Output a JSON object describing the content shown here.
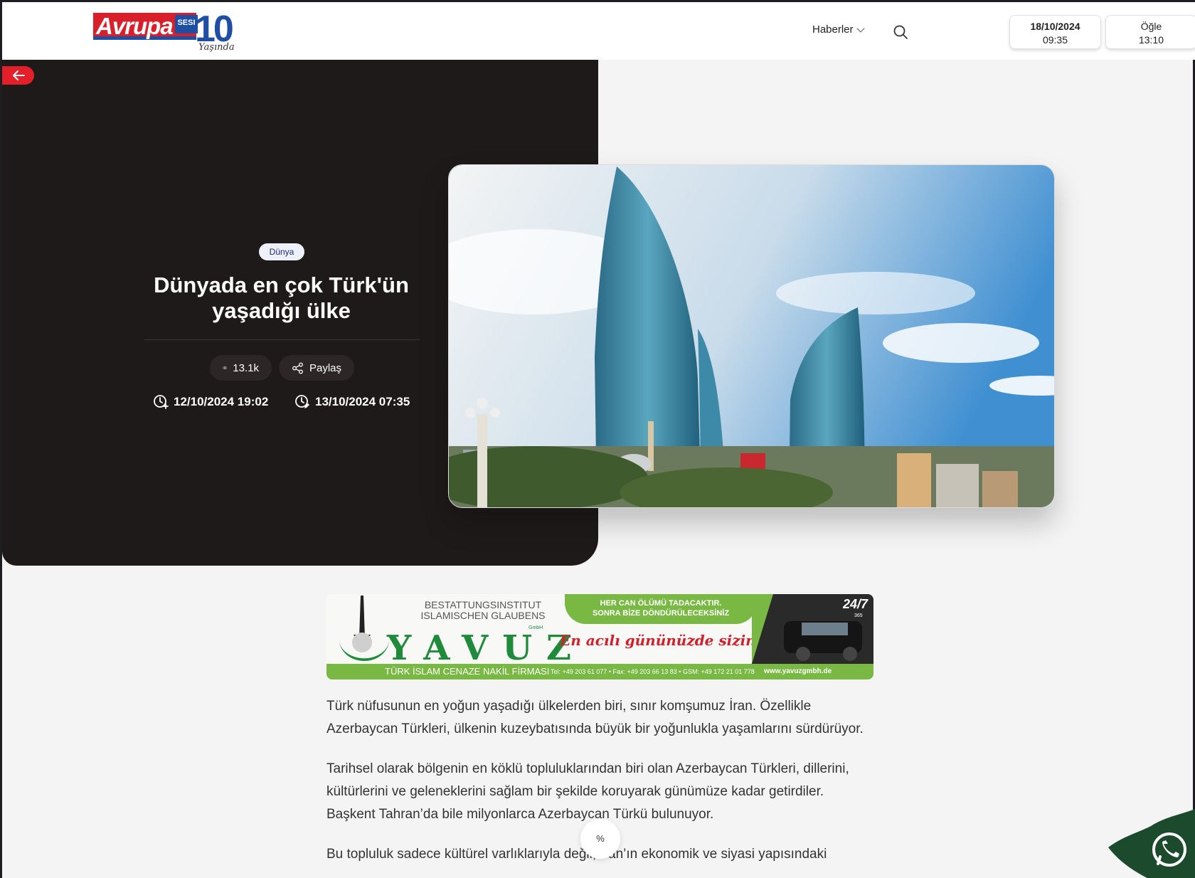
{
  "header": {
    "logo": {
      "word": "Avrupa",
      "sub": "SESI",
      "number": "10",
      "tagline": "Yaşında"
    },
    "nav_haberler": "Haberler",
    "date_box": {
      "date": "18/10/2024",
      "time": "09:35"
    },
    "prayer_box": {
      "name": "Öğle",
      "time": "13:10"
    }
  },
  "hero": {
    "category": "Dünya",
    "title": "Dünyada en çok Türk'ün yaşadığı ülke",
    "views": "13.1k",
    "share": "Paylaş",
    "published": "12/10/2024 19:02",
    "updated": "13/10/2024 07:35"
  },
  "ad": {
    "top_text_1": "BESTATTUNGSINSTITUT",
    "top_text_2": "ISLAMISCHEN GLAUBENS",
    "name": "YAVUZ",
    "gmbh": "GmbH",
    "quote_1": "HER CAN ÖLÜMÜ TADACAKTIR.",
    "quote_2": "SONRA BİZE DÖNDÜRÜLECEKSİNİZ",
    "slogan": "En acılı gününüzde sizinleyiz",
    "firma": "TÜRK İSLAM CENAZE NAKİL FİRMASI",
    "phones": "Tel: +49 203 61 077 • Fax: +49 203 66 13 83 • GSM: +49 172 21 01 778",
    "web": "www.yavuzgmbh.de",
    "badge": "24/7",
    "badge_sub": "365"
  },
  "article": {
    "p1": "Türk nüfusunun en yoğun yaşadığı ülkelerden biri, sınır komşumuz İran. Özellikle Azerbaycan Türkleri, ülkenin kuzeybatısında büyük bir yoğunlukla yaşamlarını sürdürüyor.",
    "p2": " Tarihsel olarak bölgenin en köklü topluluklarından biri olan Azerbaycan Türkleri, dillerini, kültürlerini ve geleneklerini sağlam bir şekilde koruyarak günümüze kadar getirdiler. Başkent Tahran’da bile milyonlarca Azerbaycan Türkü bulunuyor.",
    "p3": "Bu topluluk sadece kültürel varlıklarıyla değil, İran’ın ekonomik ve siyasi yapısındaki"
  },
  "floating": {
    "percent": "%"
  },
  "colors": {
    "accent": "#e3202a",
    "hero_bg": "#1e1a19",
    "ad_green": "#78b843"
  },
  "icons": [
    "back-arrow-icon",
    "search-icon",
    "chevron-down-icon",
    "eye-icon",
    "share-icon",
    "clock-plus-icon",
    "clock-edit-icon",
    "whatsapp-icon"
  ]
}
